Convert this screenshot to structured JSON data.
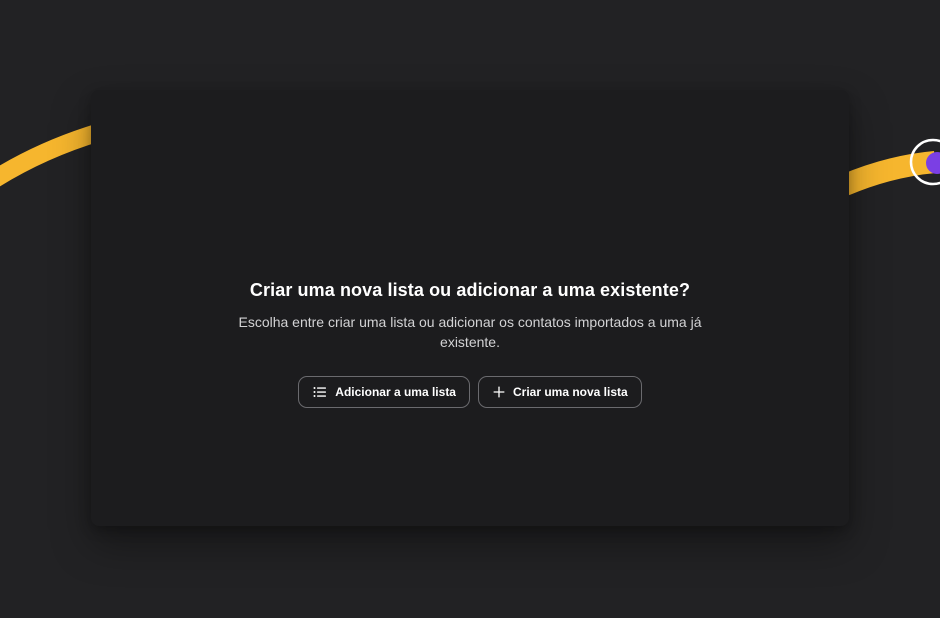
{
  "dialog": {
    "title": "Criar uma nova lista ou adicionar a uma existente?",
    "subtitle": "Escolha entre criar uma lista ou adicionar os contatos importados a uma já existente.",
    "buttons": [
      {
        "label": "Adicionar a uma lista",
        "icon": "list-icon"
      },
      {
        "label": "Criar uma nova lista",
        "icon": "plus-icon"
      }
    ]
  },
  "colors": {
    "background": "#222224",
    "card": "#1c1c1e",
    "accent_yellow": "#f6b62e",
    "accent_purple": "#7b3fe4",
    "button_border": "#6a6a6e"
  }
}
